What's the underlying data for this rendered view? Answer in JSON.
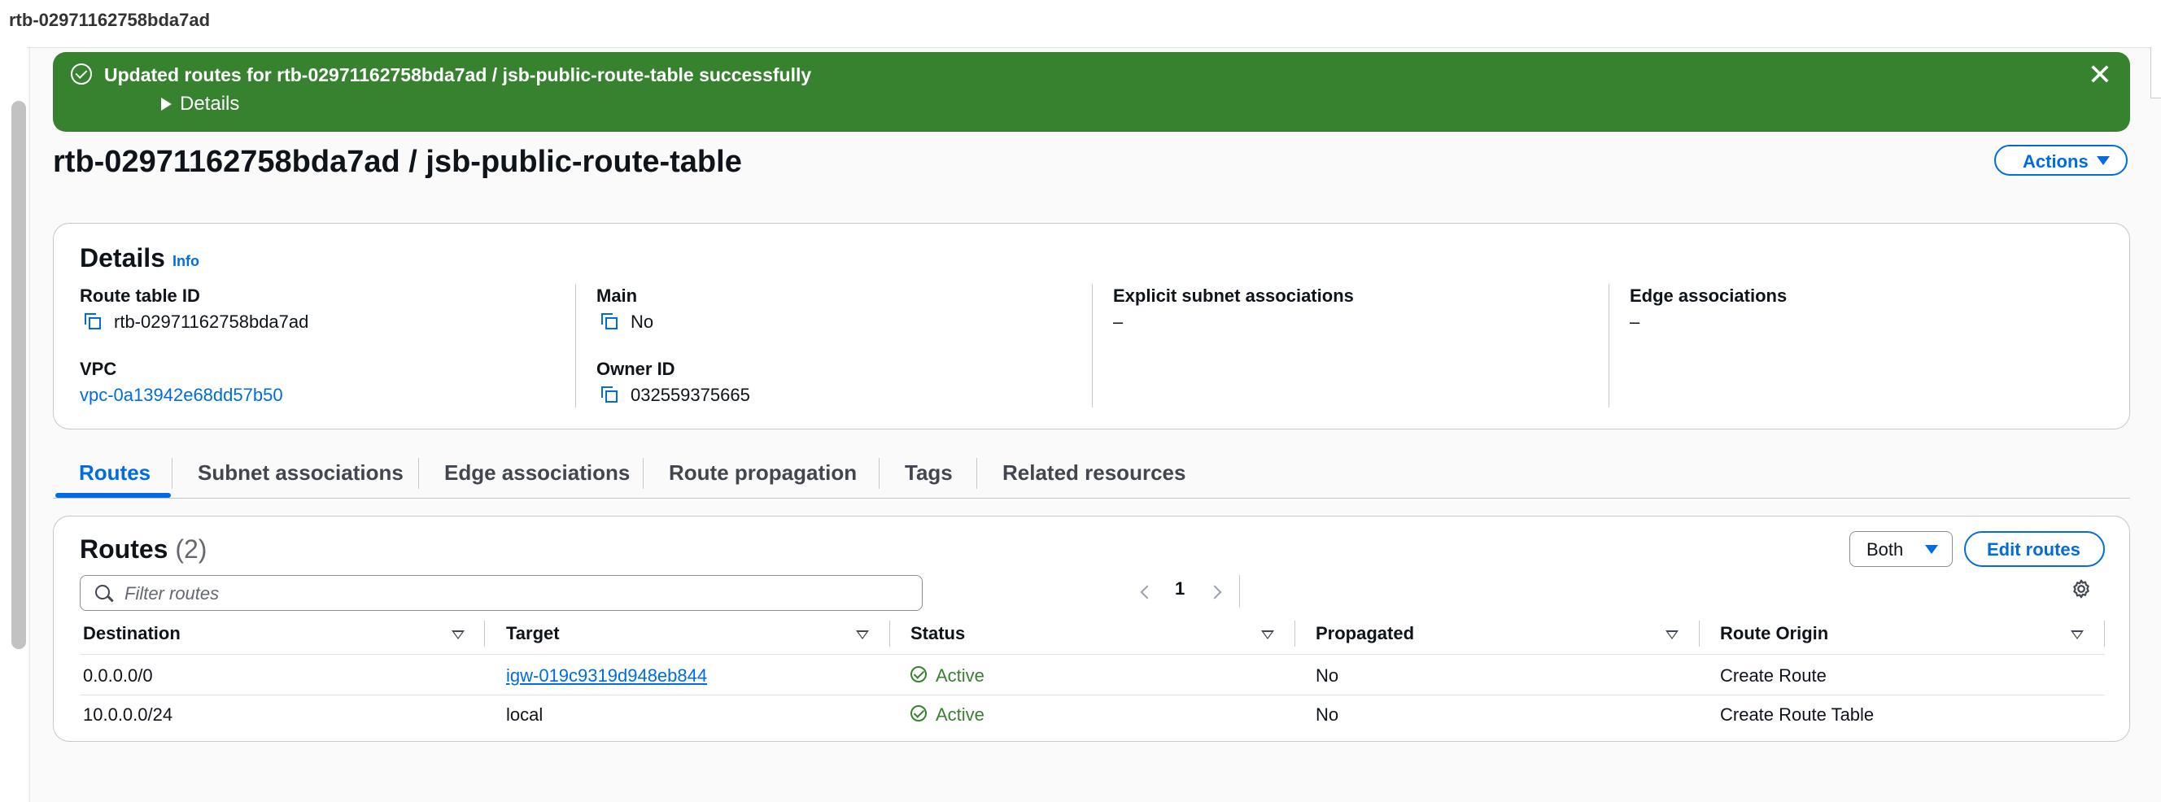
{
  "window_title": "rtb-02971162758bda7ad",
  "flash": {
    "message": "Updated routes for rtb-02971162758bda7ad / jsb-public-route-table successfully",
    "details_label": "Details",
    "bg_color": "#37822f"
  },
  "page": {
    "title": "rtb-02971162758bda7ad / jsb-public-route-table",
    "actions_label": "Actions"
  },
  "details": {
    "heading": "Details",
    "info_label": "Info",
    "route_table_id_label": "Route table ID",
    "route_table_id": "rtb-02971162758bda7ad",
    "vpc_label": "VPC",
    "vpc": "vpc-0a13942e68dd57b50",
    "main_label": "Main",
    "main": "No",
    "owner_id_label": "Owner ID",
    "owner_id": "032559375665",
    "explicit_label": "Explicit subnet associations",
    "explicit": "–",
    "edge_label": "Edge associations",
    "edge": "–"
  },
  "tabs": [
    {
      "label": "Routes",
      "active": true
    },
    {
      "label": "Subnet associations"
    },
    {
      "label": "Edge associations"
    },
    {
      "label": "Route propagation"
    },
    {
      "label": "Tags"
    },
    {
      "label": "Related resources"
    }
  ],
  "routes": {
    "heading": "Routes",
    "count": "(2)",
    "filter_select": "Both",
    "edit_label": "Edit routes",
    "filter_placeholder": "Filter routes",
    "page_number": "1",
    "columns": [
      "Destination",
      "Target",
      "Status",
      "Propagated",
      "Route Origin"
    ],
    "rows": [
      {
        "destination": "0.0.0.0/0",
        "target": "igw-019c9319d948eb844",
        "status": "Active",
        "propagated": "No",
        "origin": "Create Route"
      },
      {
        "destination": "10.0.0.0/24",
        "target": "local",
        "status": "Active",
        "propagated": "No",
        "origin": "Create Route Table"
      }
    ]
  },
  "colors": {
    "link": "#006ce0",
    "success": "#37822f"
  },
  "icons": [
    "check-circle-icon",
    "close-icon",
    "caret-right-icon",
    "copy-icon",
    "search-icon",
    "chevron-left-icon",
    "chevron-right-icon",
    "gear-icon",
    "caret-down-icon"
  ]
}
